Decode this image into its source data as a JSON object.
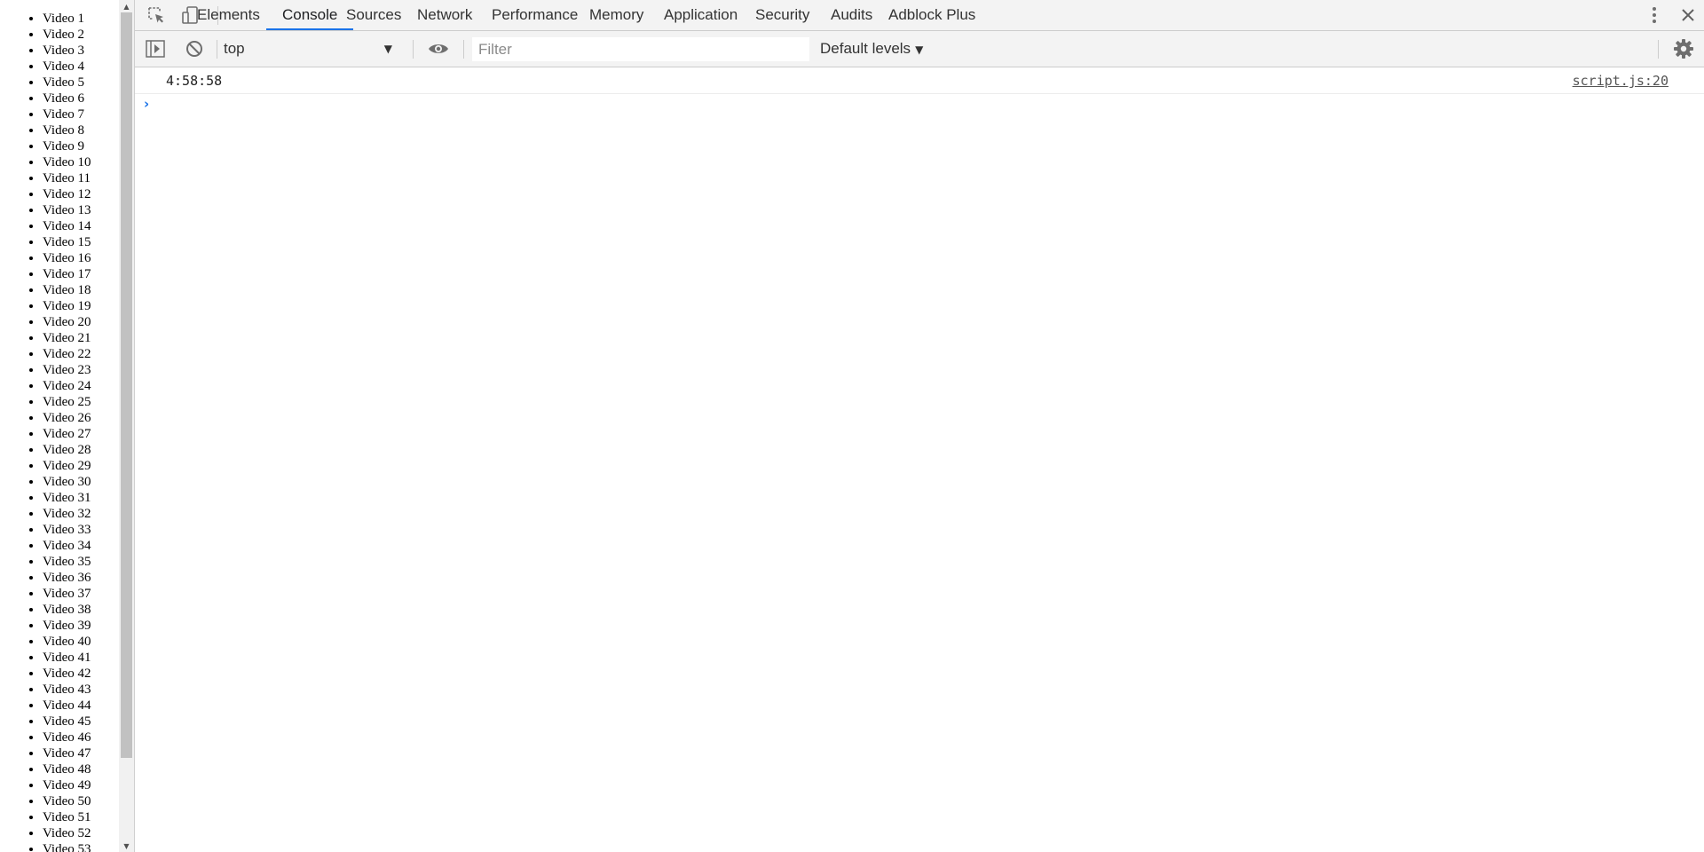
{
  "webpage": {
    "videos": [
      "Video 1",
      "Video 2",
      "Video 3",
      "Video 4",
      "Video 5",
      "Video 6",
      "Video 7",
      "Video 8",
      "Video 9",
      "Video 10",
      "Video 11",
      "Video 12",
      "Video 13",
      "Video 14",
      "Video 15",
      "Video 16",
      "Video 17",
      "Video 18",
      "Video 19",
      "Video 20",
      "Video 21",
      "Video 22",
      "Video 23",
      "Video 24",
      "Video 25",
      "Video 26",
      "Video 27",
      "Video 28",
      "Video 29",
      "Video 30",
      "Video 31",
      "Video 32",
      "Video 33",
      "Video 34",
      "Video 35",
      "Video 36",
      "Video 37",
      "Video 38",
      "Video 39",
      "Video 40",
      "Video 41",
      "Video 42",
      "Video 43",
      "Video 44",
      "Video 45",
      "Video 46",
      "Video 47",
      "Video 48",
      "Video 49",
      "Video 50",
      "Video 51",
      "Video 52",
      "Video 53"
    ]
  },
  "devtools": {
    "tabs": [
      {
        "label": "Elements",
        "active": false
      },
      {
        "label": "Console",
        "active": true
      },
      {
        "label": "Sources",
        "active": false
      },
      {
        "label": "Network",
        "active": false
      },
      {
        "label": "Performance",
        "active": false
      },
      {
        "label": "Memory",
        "active": false
      },
      {
        "label": "Application",
        "active": false
      },
      {
        "label": "Security",
        "active": false
      },
      {
        "label": "Audits",
        "active": false
      },
      {
        "label": "Adblock Plus",
        "active": false
      }
    ],
    "icons": {
      "inspect": "inspect-element-icon",
      "device": "device-toolbar-icon",
      "more": "more-vertical-icon",
      "close": "close-icon",
      "sidebar": "show-sidebar-icon",
      "clear": "clear-console-icon",
      "eye": "live-expression-icon",
      "settings": "gear-icon"
    },
    "toolbar": {
      "context": "top",
      "filter_placeholder": "Filter",
      "filter_value": "",
      "levels": "Default levels"
    },
    "console": {
      "messages": [
        {
          "text": "4:58:58",
          "source": "script.js:20"
        }
      ],
      "prompt": "›"
    },
    "colors": {
      "accent": "#1a73e8",
      "toolbar_bg": "#f3f3f3"
    }
  }
}
